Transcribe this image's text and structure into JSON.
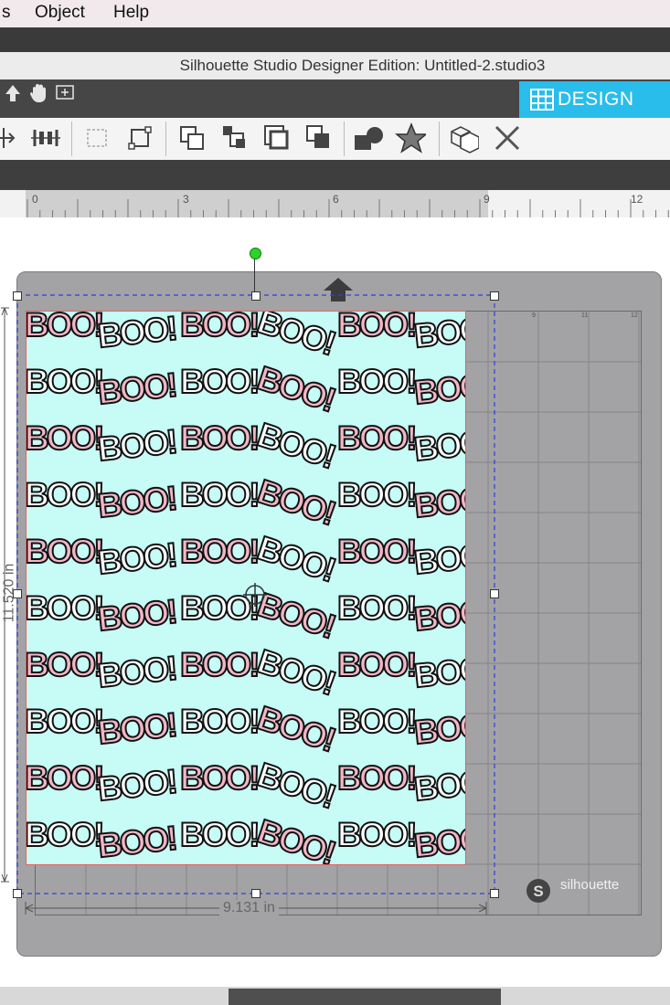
{
  "menu": {
    "items": [
      "s",
      "Object",
      "Help"
    ]
  },
  "window": {
    "title": "Silhouette Studio Designer Edition: Untitled-2.studio3"
  },
  "mode_tab": {
    "label": "DESIGN",
    "color": "#29bdec"
  },
  "ruler": {
    "marks": [
      "0",
      "3",
      "6",
      "9",
      "12"
    ]
  },
  "mat_ruler": {
    "marks": [
      "9",
      "11",
      "12"
    ]
  },
  "pattern": {
    "word": "BOO!",
    "background_color": "#c6fbf6",
    "ink_colors": [
      "#ffffff",
      "#f3b6c6"
    ],
    "rows": 10,
    "columns": 6
  },
  "dimensions": {
    "width": "9.131 in",
    "height": "11.520 in"
  },
  "branding": {
    "logo_text": "silhouette"
  },
  "icons": {
    "mode": [
      "pointer-icon",
      "pan-hand-icon",
      "zoom-fit-icon"
    ],
    "toolbar": [
      "align-icon",
      "distribute-icon",
      "group-icon",
      "ungroup-icon",
      "bring-forward-icon",
      "send-backward-icon",
      "bring-to-front-icon",
      "send-to-back-icon",
      "shapes-icon",
      "star-icon",
      "modify-icon",
      "delete-icon"
    ]
  }
}
